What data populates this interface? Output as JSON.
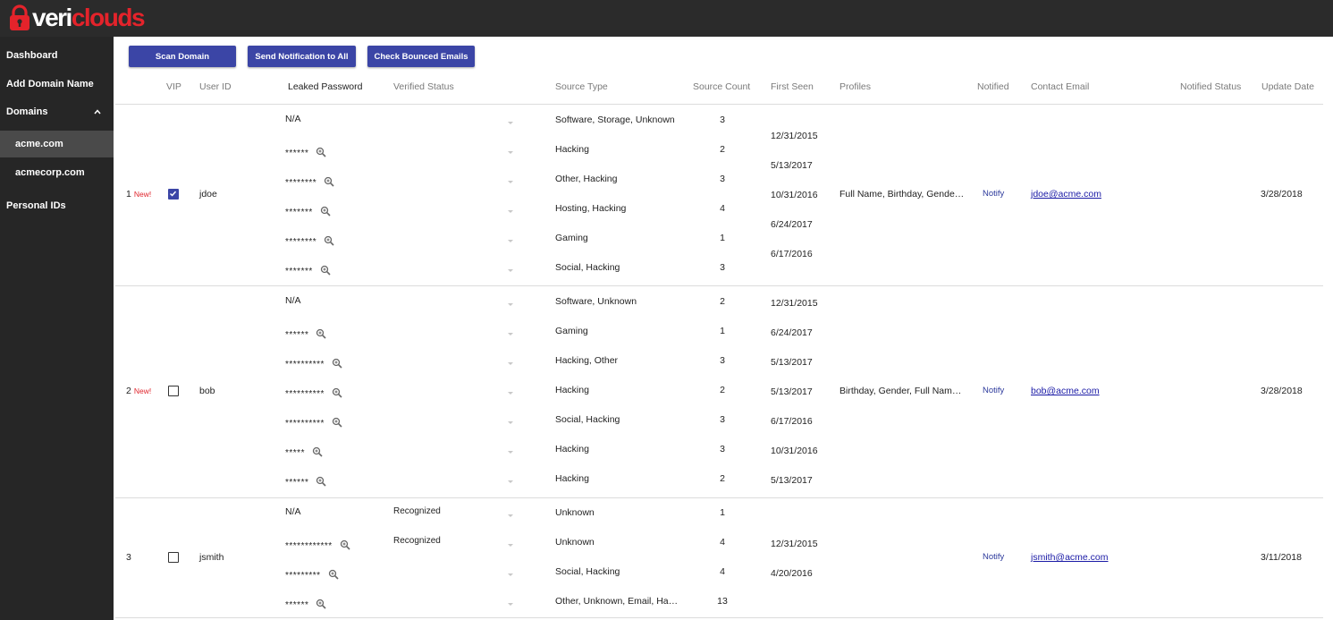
{
  "brand": {
    "name_white": "veri",
    "name_red": "clouds",
    "red": "#e4232b"
  },
  "sidebar": {
    "items": [
      {
        "label": "Dashboard"
      },
      {
        "label": "Add Domain Name"
      },
      {
        "label": "Domains"
      },
      {
        "label": "acme.com"
      },
      {
        "label": "acmecorp.com"
      },
      {
        "label": "Personal IDs"
      }
    ]
  },
  "toolbar": {
    "scan": "Scan Domain",
    "notify_all": "Send Notification to All",
    "check_bounced": "Check Bounced Emails"
  },
  "columns": {
    "vip": "VIP",
    "user_id": "User ID",
    "leaked_password": "Leaked Password",
    "verified_status": "Verified Status",
    "source_type": "Source Type",
    "source_count": "Source Count",
    "first_seen": "First Seen",
    "profiles": "Profiles",
    "notified": "Notified",
    "contact_email": "Contact Email",
    "notified_status": "Notified Status",
    "update_date": "Update Date"
  },
  "rows": [
    {
      "index": "1",
      "new": "New!",
      "vip": true,
      "user_id": "jdoe",
      "profiles": "Full Name, Birthday, Gende…",
      "notify": "Notify",
      "email": "jdoe@acme.com",
      "update_date": "3/28/2018",
      "leaks": [
        {
          "pw": "N/A",
          "verified": "",
          "source_type": "Software, Storage, Unknown",
          "count": "3"
        },
        {
          "pw": "******",
          "verified": "",
          "source_type": "Hacking",
          "count": "2"
        },
        {
          "pw": "********",
          "verified": "",
          "source_type": "Other, Hacking",
          "count": "3"
        },
        {
          "pw": "*******",
          "verified": "",
          "source_type": "Hosting, Hacking",
          "count": "4"
        },
        {
          "pw": "********",
          "verified": "",
          "source_type": "Gaming",
          "count": "1"
        },
        {
          "pw": "*******",
          "verified": "",
          "source_type": "Social, Hacking",
          "count": "3"
        }
      ],
      "first_seen": [
        "12/31/2015",
        "5/13/2017",
        "10/31/2016",
        "6/24/2017",
        "6/17/2016"
      ]
    },
    {
      "index": "2",
      "new": "New!",
      "vip": false,
      "user_id": "bob",
      "profiles": "Birthday, Gender, Full Nam…",
      "notify": "Notify",
      "email": "bob@acme.com",
      "update_date": "3/28/2018",
      "leaks": [
        {
          "pw": "N/A",
          "verified": "",
          "source_type": "Software, Unknown",
          "count": "2"
        },
        {
          "pw": "******",
          "verified": "",
          "source_type": "Gaming",
          "count": "1"
        },
        {
          "pw": "**********",
          "verified": "",
          "source_type": "Hacking, Other",
          "count": "3"
        },
        {
          "pw": "**********",
          "verified": "",
          "source_type": "Hacking",
          "count": "2"
        },
        {
          "pw": "**********",
          "verified": "",
          "source_type": "Social, Hacking",
          "count": "3"
        },
        {
          "pw": "*****",
          "verified": "",
          "source_type": "Hacking",
          "count": "3"
        },
        {
          "pw": "******",
          "verified": "",
          "source_type": "Hacking",
          "count": "2"
        }
      ],
      "first_seen": [
        "12/31/2015",
        "6/24/2017",
        "5/13/2017",
        "5/13/2017",
        "6/17/2016",
        "10/31/2016",
        "5/13/2017"
      ]
    },
    {
      "index": "3",
      "new": "",
      "vip": false,
      "user_id": "jsmith",
      "profiles": "",
      "notify": "Notify",
      "email": "jsmith@acme.com",
      "update_date": "3/11/2018",
      "leaks": [
        {
          "pw": "N/A",
          "verified": "Recognized",
          "source_type": "Unknown",
          "count": "1"
        },
        {
          "pw": "************",
          "verified": "Recognized",
          "source_type": "Unknown",
          "count": "4"
        },
        {
          "pw": "*********",
          "verified": "",
          "source_type": "Social, Hacking",
          "count": "4"
        },
        {
          "pw": "******",
          "verified": "",
          "source_type": "Other, Unknown, Email, Ha…",
          "count": "13"
        }
      ],
      "first_seen": [
        "12/31/2015",
        "4/20/2016"
      ]
    }
  ]
}
